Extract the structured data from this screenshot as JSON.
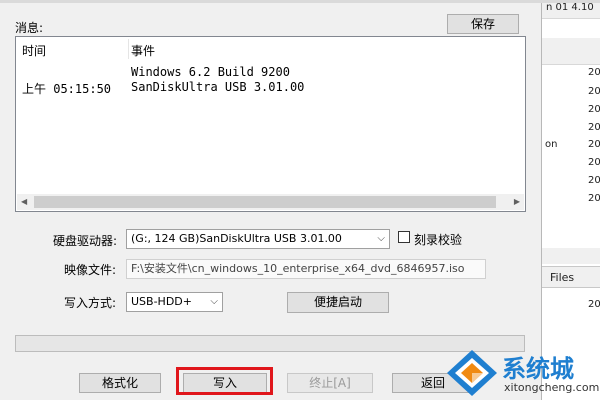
{
  "messages": {
    "label": "消息:",
    "save_button": "保存",
    "columns": {
      "time": "时间",
      "event": "事件"
    },
    "rows": [
      {
        "time": "",
        "event": "Windows 6.2 Build 9200"
      },
      {
        "time": "上午 05:15:50",
        "event": "SanDiskUltra USB 3.01.00"
      }
    ]
  },
  "drive": {
    "label": "硬盘驱动器:",
    "value": "(G:, 124 GB)SanDiskUltra USB 3.01.00",
    "verify_label": "刻录校验",
    "verify_checked": false
  },
  "image_file": {
    "label": "映像文件:",
    "value": "F:\\安装文件\\cn_windows_10_enterprise_x64_dvd_6846957.iso"
  },
  "write_mode": {
    "label": "写入方式:",
    "value": "USB-HDD+",
    "quick_boot_button": "便捷启动"
  },
  "progress": {
    "value": 0
  },
  "actions": {
    "format": "格式化",
    "write": "写入",
    "stop": "终止[A]",
    "back": "返回"
  },
  "background_window": {
    "title_fragment": "n 01 4.10",
    "files_header": "Files",
    "on_fragment": "on",
    "year_fragments": [
      "20",
      "20",
      "20",
      "20",
      "20",
      "20",
      "20",
      "20",
      "20"
    ]
  },
  "watermark": {
    "brand": "系统城",
    "url": "xitongcheng.com"
  },
  "colors": {
    "highlight": "#e0161b",
    "watermark_blue": "#1f7fd0",
    "watermark_orange": "#f08a12"
  }
}
